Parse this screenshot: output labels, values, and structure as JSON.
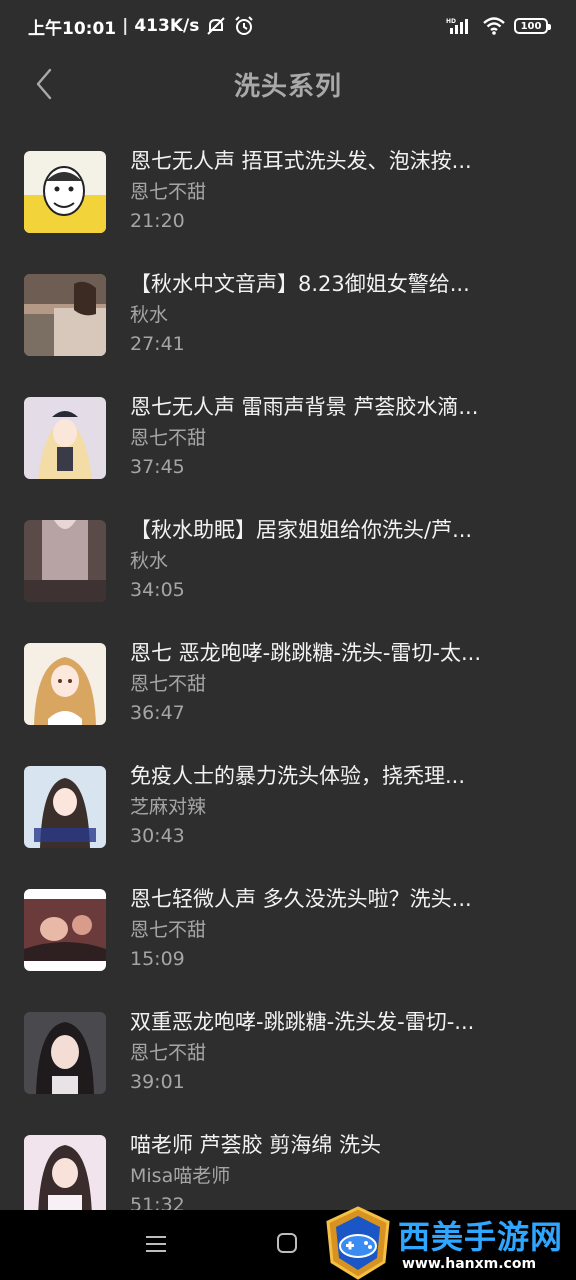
{
  "status_bar": {
    "time": "上午10:01",
    "separator": "|",
    "speed": "413K/s",
    "hd_label": "HD",
    "battery": "100",
    "icons": [
      "mute-icon",
      "alarm-icon",
      "signal-icon",
      "wifi-icon",
      "battery-icon"
    ]
  },
  "header": {
    "title": "洗头系列",
    "back_icon": "chevron-left-icon"
  },
  "items": [
    {
      "title": "恩七无人声 捂耳式洗头发、泡沫按...",
      "author": "恩七不甜",
      "duration": "21:20"
    },
    {
      "title": "【秋水中文音声】8.23御姐女警给...",
      "author": "秋水",
      "duration": "27:41"
    },
    {
      "title": "恩七无人声 雷雨声背景 芦荟胶水滴...",
      "author": "恩七不甜",
      "duration": "37:45"
    },
    {
      "title": "【秋水助眠】居家姐姐给你洗头/芦...",
      "author": "秋水",
      "duration": "34:05"
    },
    {
      "title": "恩七 恶龙咆哮-跳跳糖-洗头-雷切-太...",
      "author": "恩七不甜",
      "duration": "36:47"
    },
    {
      "title": "免疫人士的暴力洗头体验，挠秃理...",
      "author": "芝麻对辣",
      "duration": "30:43"
    },
    {
      "title": "恩七轻微人声 多久没洗头啦？洗头...",
      "author": "恩七不甜",
      "duration": "15:09"
    },
    {
      "title": "双重恶龙咆哮-跳跳糖-洗头发-雷切-...",
      "author": "恩七不甜",
      "duration": "39:01"
    },
    {
      "title": "喵老师 芦荟胶 剪海绵 洗头",
      "author": "Misa喵老师",
      "duration": "51:32"
    }
  ],
  "nav_bar": {
    "icons": [
      "menu-icon",
      "home-icon"
    ]
  },
  "watermark": {
    "name": "西美手游网",
    "url": "www.hanxm.com"
  }
}
